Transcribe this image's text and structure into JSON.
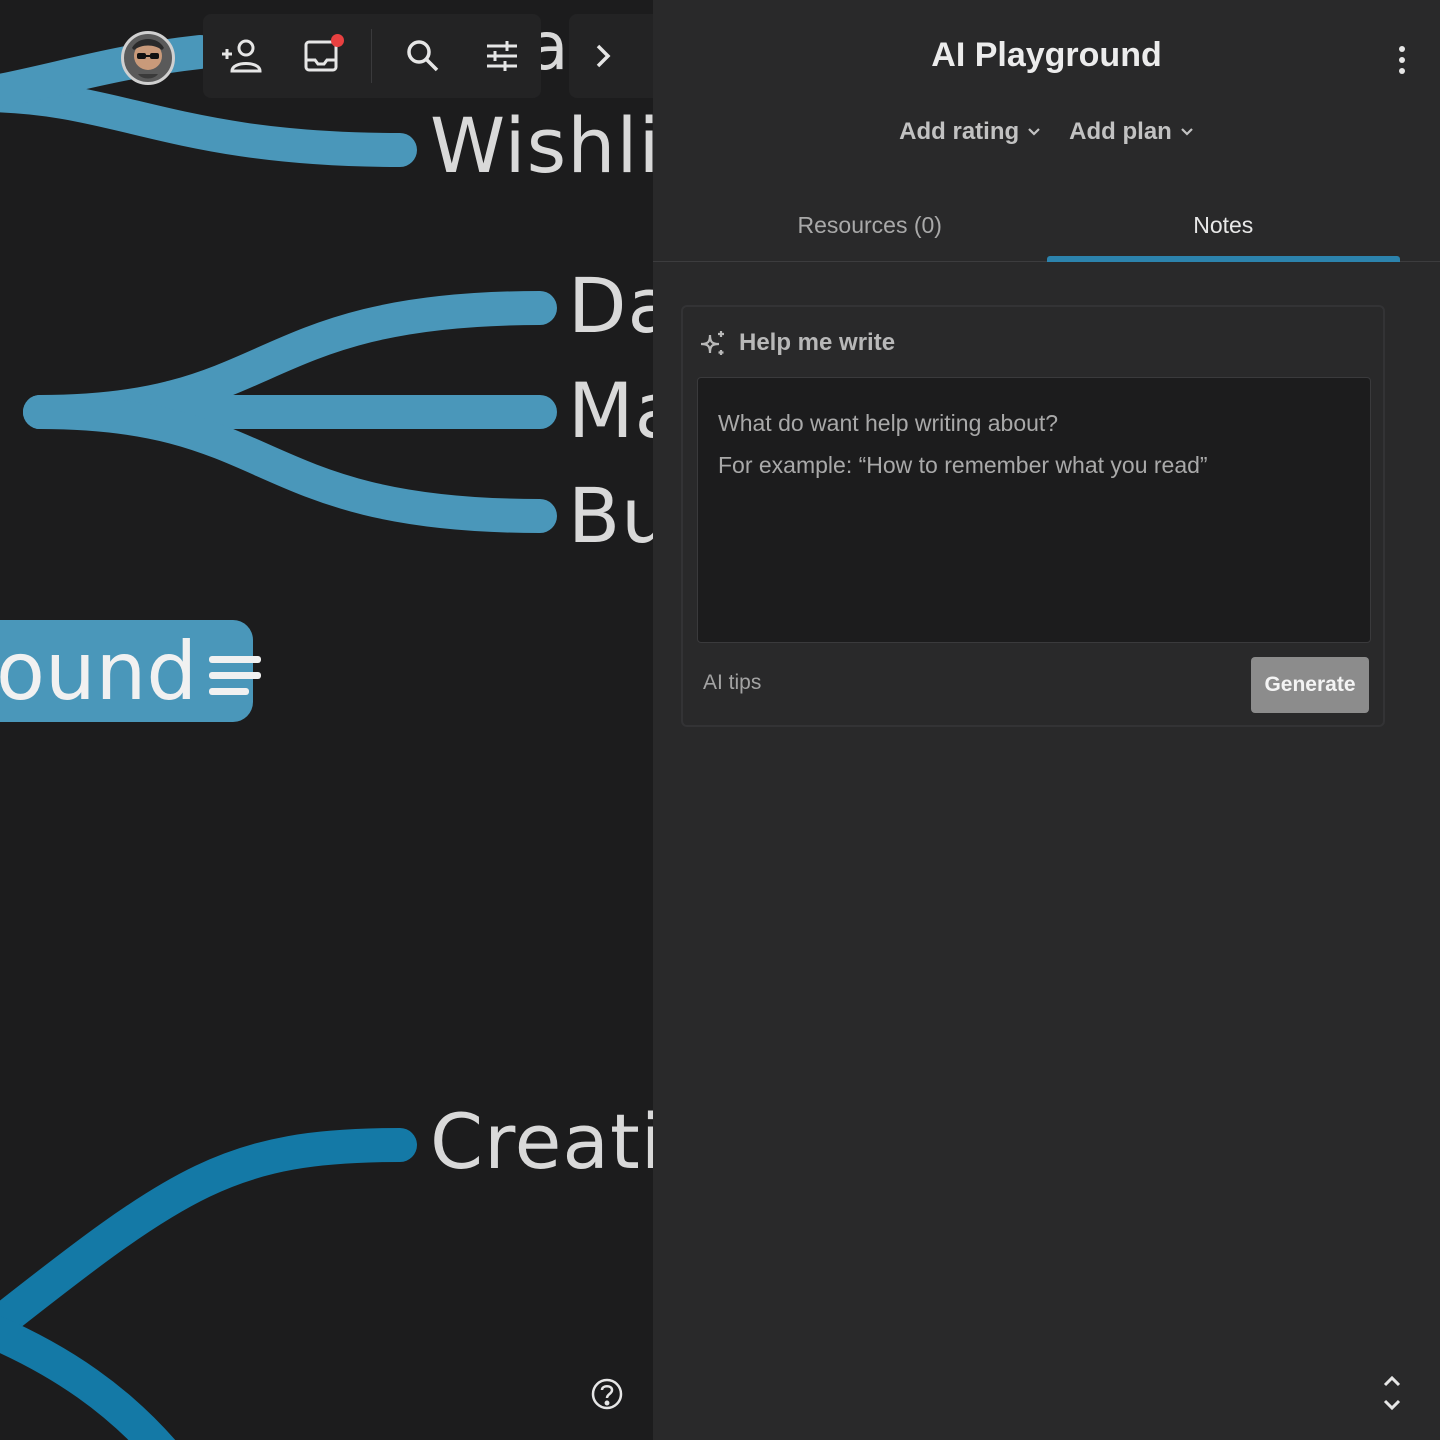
{
  "canvas": {
    "nodes": {
      "top_partial": "a",
      "wishlist": "Wishli",
      "da": "Da",
      "ma": "Ma",
      "bu": "Bu",
      "pill": "ound",
      "create": "Creati"
    },
    "branch_colors": {
      "light": "#4a97ba",
      "dark": "#1479a6"
    },
    "toolbar": {
      "icons": [
        "add-person-icon",
        "inbox-icon",
        "search-icon",
        "sliders-icon"
      ],
      "next_icon": "chevron-right-icon",
      "notification_color": "#e84040"
    },
    "help_icon": "help-circle-icon"
  },
  "panel": {
    "title": "AI Playground",
    "meta": {
      "add_rating": "Add rating",
      "add_plan": "Add plan"
    },
    "tabs": [
      {
        "label": "Resources (0)",
        "active": false
      },
      {
        "label": "Notes",
        "active": true
      }
    ],
    "accent_color": "#2c83ad",
    "help_write": {
      "heading": "Help me write",
      "placeholder_line1": "What do want help writing about?",
      "placeholder_line2": "For example: “How to remember what you read”",
      "tips": "AI tips",
      "generate": "Generate"
    }
  }
}
